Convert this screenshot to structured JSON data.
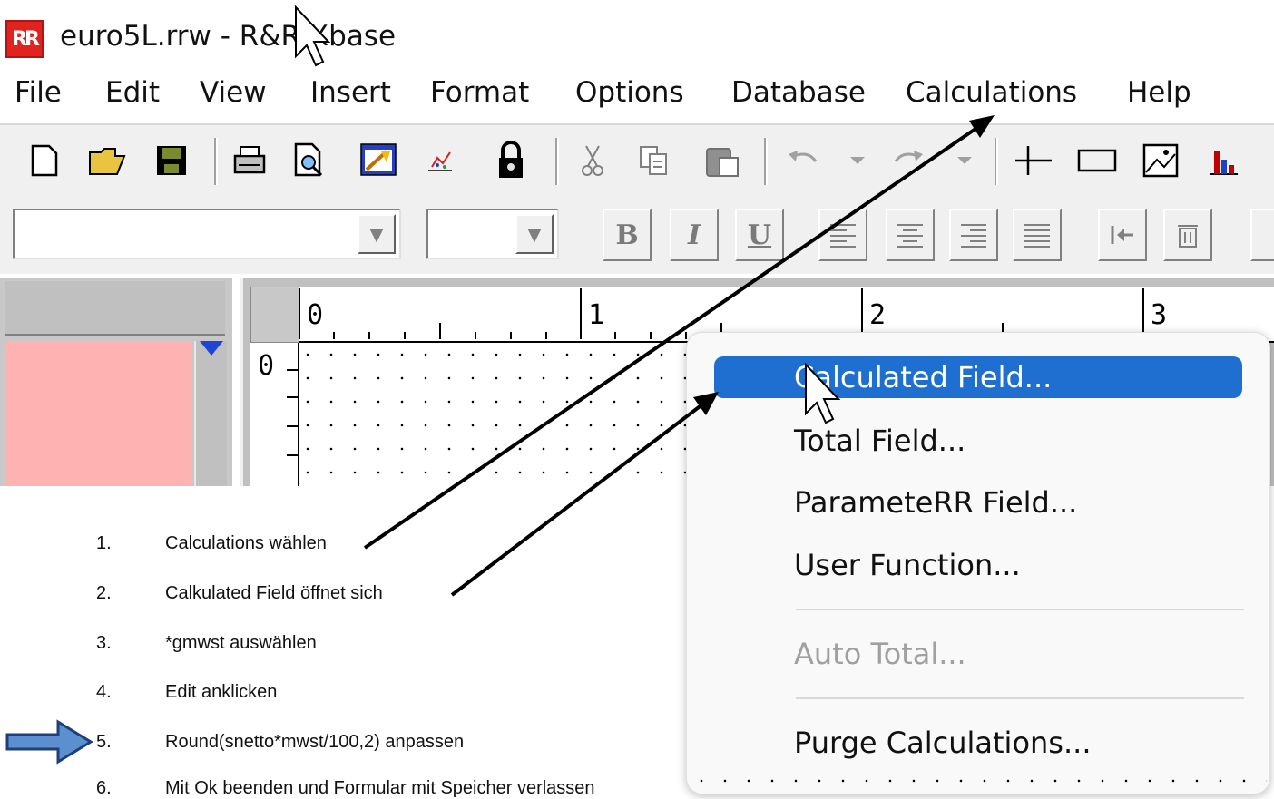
{
  "window": {
    "app_icon_text": "RR",
    "title": "euro5L.rrw - R&R Xbase"
  },
  "menubar": {
    "items": [
      "File",
      "Edit",
      "View",
      "Insert",
      "Format",
      "Options",
      "Database",
      "Calculations",
      "Help"
    ]
  },
  "toolbar1": {
    "icons": [
      "new-document-icon",
      "open-folder-icon",
      "save-disk-icon",
      "print-icon",
      "print-preview-icon",
      "report-wizard-icon",
      "chart-icon",
      "lock-icon",
      "cut-icon",
      "copy-icon",
      "paste-icon",
      "undo-icon",
      "redo-icon",
      "line-tool-icon",
      "rectangle-tool-icon",
      "picture-icon",
      "bar-chart-icon"
    ]
  },
  "toolbar2": {
    "font_combo_value": "",
    "size_combo_value": "",
    "bold_label": "B",
    "italic_label": "I",
    "underline_label": "U"
  },
  "ruler": {
    "h_labels": [
      "0",
      "1",
      "2",
      "3"
    ],
    "v_labels": [
      "0"
    ]
  },
  "context_menu": {
    "items": [
      {
        "label": "Calculated Field...",
        "state": "highlighted"
      },
      {
        "label": "Total Field...",
        "state": "normal"
      },
      {
        "label": "ParameteRR Field...",
        "state": "normal"
      },
      {
        "label": "User Function...",
        "state": "normal"
      },
      {
        "label": "Auto Total...",
        "state": "disabled"
      },
      {
        "label": "Purge Calculations...",
        "state": "normal"
      }
    ]
  },
  "instructions": [
    {
      "num": "1.",
      "text": "Calculations wählen"
    },
    {
      "num": "2.",
      "text": "Calkulated Field öffnet sich"
    },
    {
      "num": "3.",
      "text": "*gmwst auswählen"
    },
    {
      "num": "4.",
      "text": "Edit anklicken"
    },
    {
      "num": "5.",
      "text": "Round(snetto*mwst/100,2) anpassen"
    },
    {
      "num": "6.",
      "text": "Mit Ok beenden und Formular mit Speicher verlassen"
    }
  ],
  "colors": {
    "highlight": "#1e6fd0",
    "pink_area": "#ffb2b2",
    "callout_arrow": "#5b8fcf"
  }
}
